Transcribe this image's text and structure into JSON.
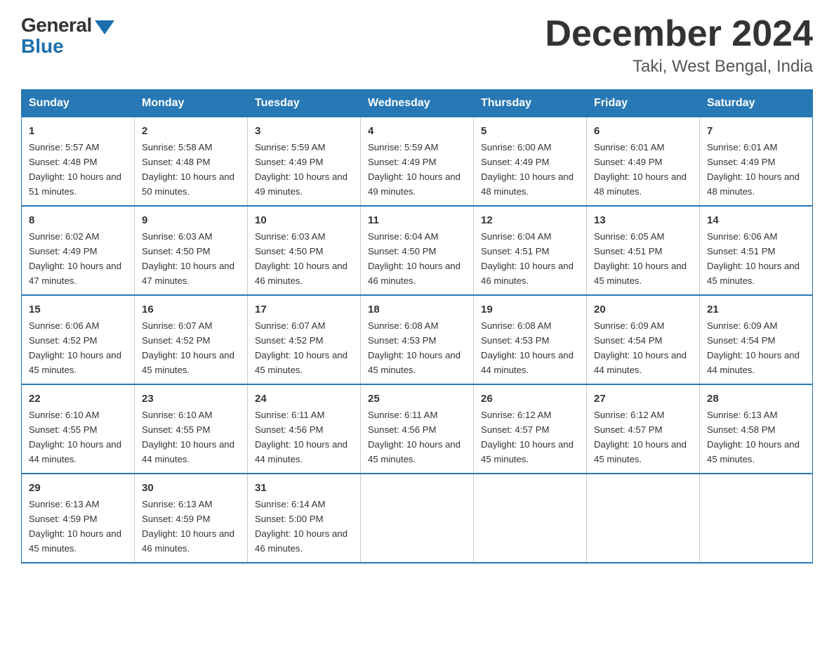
{
  "logo": {
    "general": "General",
    "blue": "Blue"
  },
  "title": "December 2024",
  "location": "Taki, West Bengal, India",
  "days_of_week": [
    "Sunday",
    "Monday",
    "Tuesday",
    "Wednesday",
    "Thursday",
    "Friday",
    "Saturday"
  ],
  "weeks": [
    [
      {
        "day": "1",
        "sunrise": "5:57 AM",
        "sunset": "4:48 PM",
        "daylight": "10 hours and 51 minutes."
      },
      {
        "day": "2",
        "sunrise": "5:58 AM",
        "sunset": "4:48 PM",
        "daylight": "10 hours and 50 minutes."
      },
      {
        "day": "3",
        "sunrise": "5:59 AM",
        "sunset": "4:49 PM",
        "daylight": "10 hours and 49 minutes."
      },
      {
        "day": "4",
        "sunrise": "5:59 AM",
        "sunset": "4:49 PM",
        "daylight": "10 hours and 49 minutes."
      },
      {
        "day": "5",
        "sunrise": "6:00 AM",
        "sunset": "4:49 PM",
        "daylight": "10 hours and 48 minutes."
      },
      {
        "day": "6",
        "sunrise": "6:01 AM",
        "sunset": "4:49 PM",
        "daylight": "10 hours and 48 minutes."
      },
      {
        "day": "7",
        "sunrise": "6:01 AM",
        "sunset": "4:49 PM",
        "daylight": "10 hours and 48 minutes."
      }
    ],
    [
      {
        "day": "8",
        "sunrise": "6:02 AM",
        "sunset": "4:49 PM",
        "daylight": "10 hours and 47 minutes."
      },
      {
        "day": "9",
        "sunrise": "6:03 AM",
        "sunset": "4:50 PM",
        "daylight": "10 hours and 47 minutes."
      },
      {
        "day": "10",
        "sunrise": "6:03 AM",
        "sunset": "4:50 PM",
        "daylight": "10 hours and 46 minutes."
      },
      {
        "day": "11",
        "sunrise": "6:04 AM",
        "sunset": "4:50 PM",
        "daylight": "10 hours and 46 minutes."
      },
      {
        "day": "12",
        "sunrise": "6:04 AM",
        "sunset": "4:51 PM",
        "daylight": "10 hours and 46 minutes."
      },
      {
        "day": "13",
        "sunrise": "6:05 AM",
        "sunset": "4:51 PM",
        "daylight": "10 hours and 45 minutes."
      },
      {
        "day": "14",
        "sunrise": "6:06 AM",
        "sunset": "4:51 PM",
        "daylight": "10 hours and 45 minutes."
      }
    ],
    [
      {
        "day": "15",
        "sunrise": "6:06 AM",
        "sunset": "4:52 PM",
        "daylight": "10 hours and 45 minutes."
      },
      {
        "day": "16",
        "sunrise": "6:07 AM",
        "sunset": "4:52 PM",
        "daylight": "10 hours and 45 minutes."
      },
      {
        "day": "17",
        "sunrise": "6:07 AM",
        "sunset": "4:52 PM",
        "daylight": "10 hours and 45 minutes."
      },
      {
        "day": "18",
        "sunrise": "6:08 AM",
        "sunset": "4:53 PM",
        "daylight": "10 hours and 45 minutes."
      },
      {
        "day": "19",
        "sunrise": "6:08 AM",
        "sunset": "4:53 PM",
        "daylight": "10 hours and 44 minutes."
      },
      {
        "day": "20",
        "sunrise": "6:09 AM",
        "sunset": "4:54 PM",
        "daylight": "10 hours and 44 minutes."
      },
      {
        "day": "21",
        "sunrise": "6:09 AM",
        "sunset": "4:54 PM",
        "daylight": "10 hours and 44 minutes."
      }
    ],
    [
      {
        "day": "22",
        "sunrise": "6:10 AM",
        "sunset": "4:55 PM",
        "daylight": "10 hours and 44 minutes."
      },
      {
        "day": "23",
        "sunrise": "6:10 AM",
        "sunset": "4:55 PM",
        "daylight": "10 hours and 44 minutes."
      },
      {
        "day": "24",
        "sunrise": "6:11 AM",
        "sunset": "4:56 PM",
        "daylight": "10 hours and 44 minutes."
      },
      {
        "day": "25",
        "sunrise": "6:11 AM",
        "sunset": "4:56 PM",
        "daylight": "10 hours and 45 minutes."
      },
      {
        "day": "26",
        "sunrise": "6:12 AM",
        "sunset": "4:57 PM",
        "daylight": "10 hours and 45 minutes."
      },
      {
        "day": "27",
        "sunrise": "6:12 AM",
        "sunset": "4:57 PM",
        "daylight": "10 hours and 45 minutes."
      },
      {
        "day": "28",
        "sunrise": "6:13 AM",
        "sunset": "4:58 PM",
        "daylight": "10 hours and 45 minutes."
      }
    ],
    [
      {
        "day": "29",
        "sunrise": "6:13 AM",
        "sunset": "4:59 PM",
        "daylight": "10 hours and 45 minutes."
      },
      {
        "day": "30",
        "sunrise": "6:13 AM",
        "sunset": "4:59 PM",
        "daylight": "10 hours and 46 minutes."
      },
      {
        "day": "31",
        "sunrise": "6:14 AM",
        "sunset": "5:00 PM",
        "daylight": "10 hours and 46 minutes."
      },
      null,
      null,
      null,
      null
    ]
  ],
  "labels": {
    "sunrise": "Sunrise:",
    "sunset": "Sunset:",
    "daylight": "Daylight:"
  }
}
